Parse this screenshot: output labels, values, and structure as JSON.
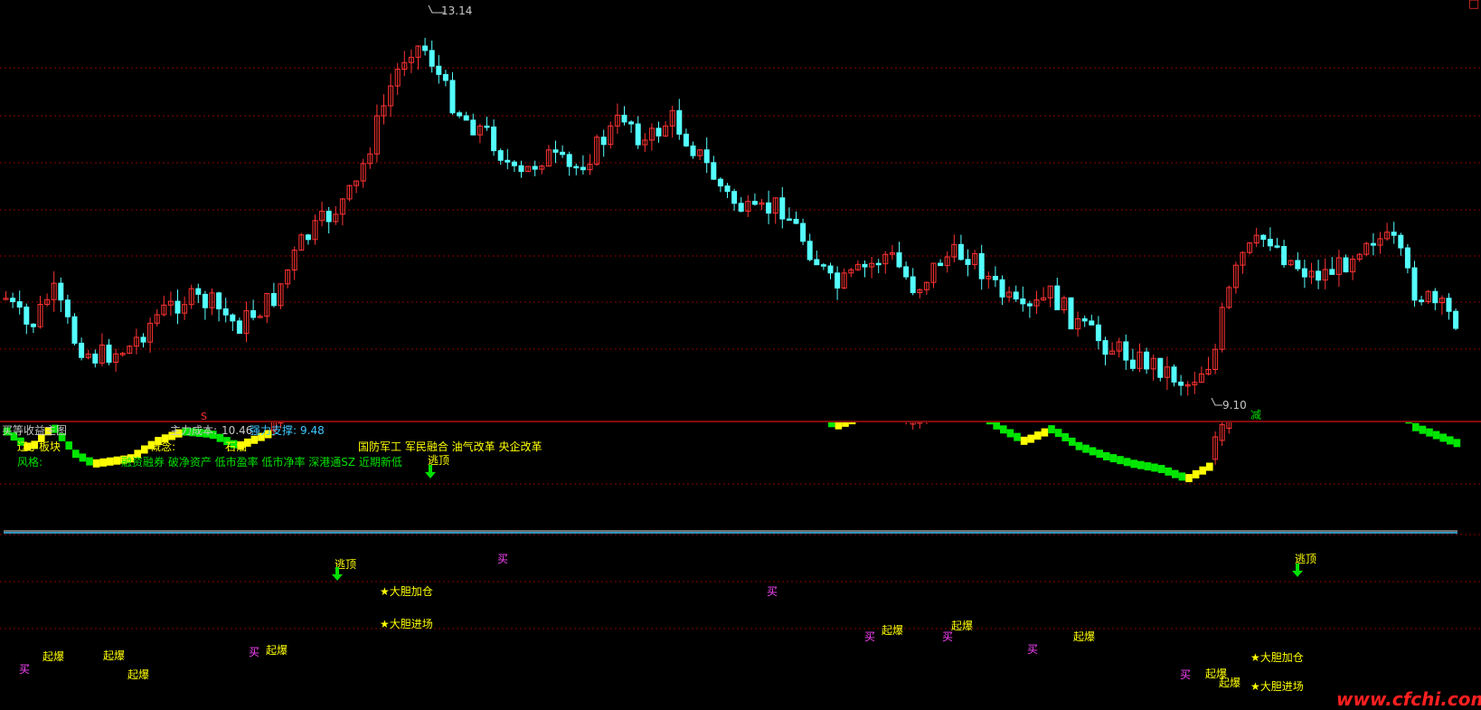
{
  "window": {
    "title": "",
    "close_glyph": "□",
    "close_icon": "square-outline-icon"
  },
  "main_chart": {
    "high_label": "13.14",
    "low_label": "9.10",
    "marker_s": "S",
    "marker_jian": "减"
  },
  "indicator": {
    "name": "买等收益主图",
    "cost_label": "主力成本:",
    "cost_value": "10.46",
    "support_label": "强力支撑:",
    "support_value": "9.48"
  },
  "info": {
    "board_label": "辽宁板块",
    "concept_label": "概念:",
    "concept_first": "石油",
    "concept_rest": "国防军工 军民融合 油气改革 央企改革",
    "style_label": "风格:",
    "style_value": "融资融券 破净资产 低市盈率 低市净率 深港通SZ 近期新低"
  },
  "signals": {
    "buy": "买",
    "burst": "起爆",
    "escape": "逃顶",
    "bold_add": "★大胆加仓",
    "bold_enter": "★大胆进场"
  },
  "watermark": "www.cfchi.com",
  "colors": {
    "background": "#000000",
    "up_red": "#ff3333",
    "down_cyan": "#54ffff",
    "grid_red": "#8b0000",
    "green_bar": "#00e600",
    "yellow": "#ffff00",
    "support_line": "#3ec8ff",
    "cost_line": "#b4b4b4",
    "buy_magenta": "#ff44ff",
    "watermark_red": "#ff2020"
  }
}
